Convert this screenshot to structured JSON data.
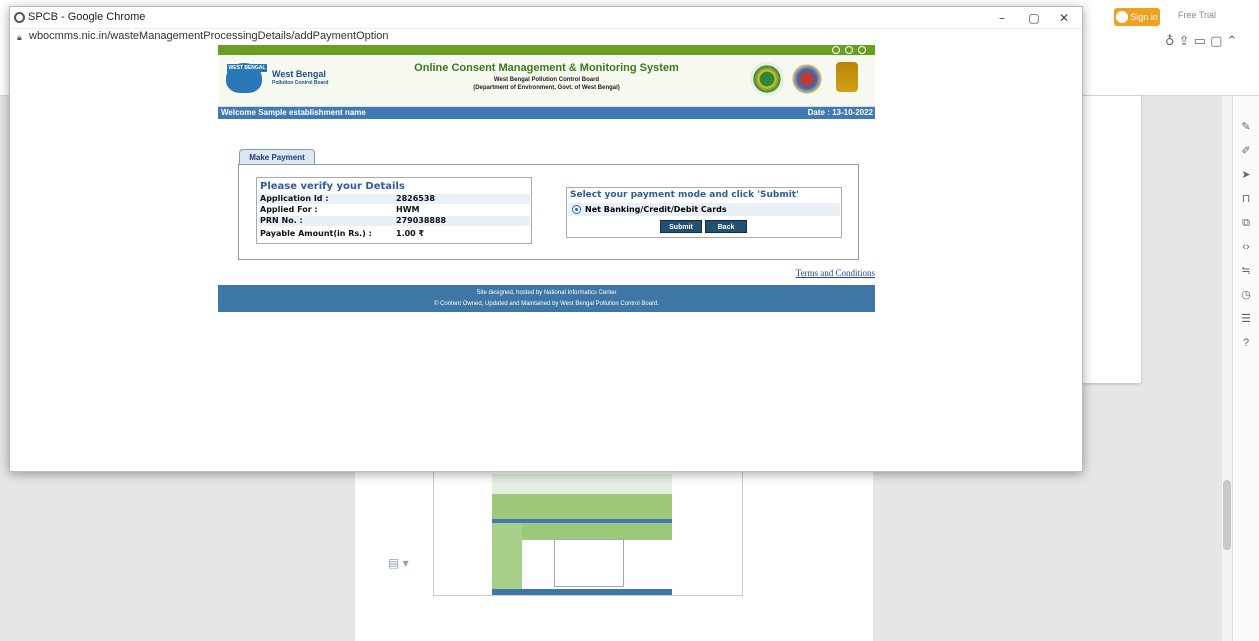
{
  "window": {
    "title": "SPCB - Google Chrome",
    "url": "wbocmms.nic.in/wasteManagementProcessingDetails/addPaymentOption"
  },
  "background_app": {
    "signin_label": "Sign in",
    "free_trial_label": "Free Trial"
  },
  "site": {
    "logo_title": "West Bengal",
    "logo_subtitle": "Pollution Control Board",
    "logo_tag": "WEST BENGAL",
    "title": "Online Consent Management & Monitoring System",
    "subtitle1": "West Bengal Pollution Control Board",
    "subtitle2": "(Department of Environment, Govt. of West Bengal)",
    "welcome": "Welcome Sample establishment name",
    "date": "Date : 13-10-2022",
    "tab_label": "Make Payment",
    "verify": {
      "title": "Please verify your Details",
      "rows": [
        {
          "label": "Application Id :",
          "value": "2826538"
        },
        {
          "label": "Applied For :",
          "value": "HWM"
        },
        {
          "label": "PRN No. :",
          "value": "279038888"
        },
        {
          "label": "Payable Amount(in Rs.) :",
          "value": "1.00 ₹"
        }
      ]
    },
    "payment_mode": {
      "title": "Select your payment mode and click 'Submit'",
      "option_label": "Net Banking/Credit/Debit Cards",
      "selected": true,
      "submit_label": "Submit",
      "back_label": "Back"
    },
    "terms_link": "Terms and Conditions",
    "footer_line1": "Site designed, hosted by National Informatics Center",
    "footer_line2": "© Content Owned, Updated and Maintained by West Bengal Pollution Control Board."
  },
  "colors": {
    "header_green": "#6a9e22",
    "welcome_blue": "#3f7ab5",
    "footer_blue": "#3e77a5",
    "button_dark": "#24506f"
  }
}
